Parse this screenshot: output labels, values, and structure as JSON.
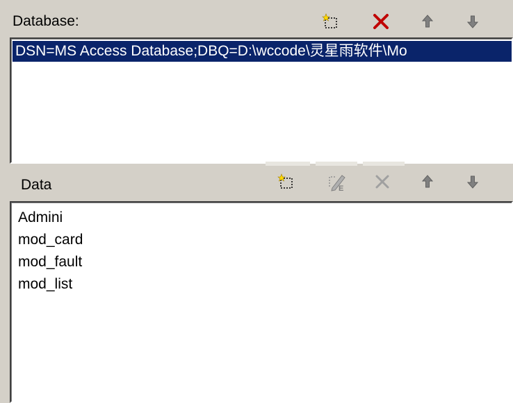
{
  "database_panel": {
    "label": "Database:",
    "toolbar": {
      "new_icon": "new-item-icon",
      "delete_icon": "delete-icon",
      "move_up_icon": "arrow-up-icon",
      "move_down_icon": "arrow-down-icon",
      "delete_color": "#c00000"
    },
    "items": [
      "DSN=MS Access Database;DBQ=D:\\wccode\\灵星雨软件\\Mo"
    ]
  },
  "data_panel": {
    "label": "Data",
    "toolbar": {
      "new_icon": "new-item-icon",
      "edit_icon": "edit-icon",
      "delete_icon": "delete-icon",
      "move_up_icon": "arrow-up-icon",
      "move_down_icon": "arrow-down-icon"
    },
    "items": [
      "Admini",
      "mod_card",
      "mod_fault",
      "mod_list"
    ]
  },
  "colors": {
    "selection_bg": "#0a246a",
    "panel_bg": "#d4d0c8"
  }
}
